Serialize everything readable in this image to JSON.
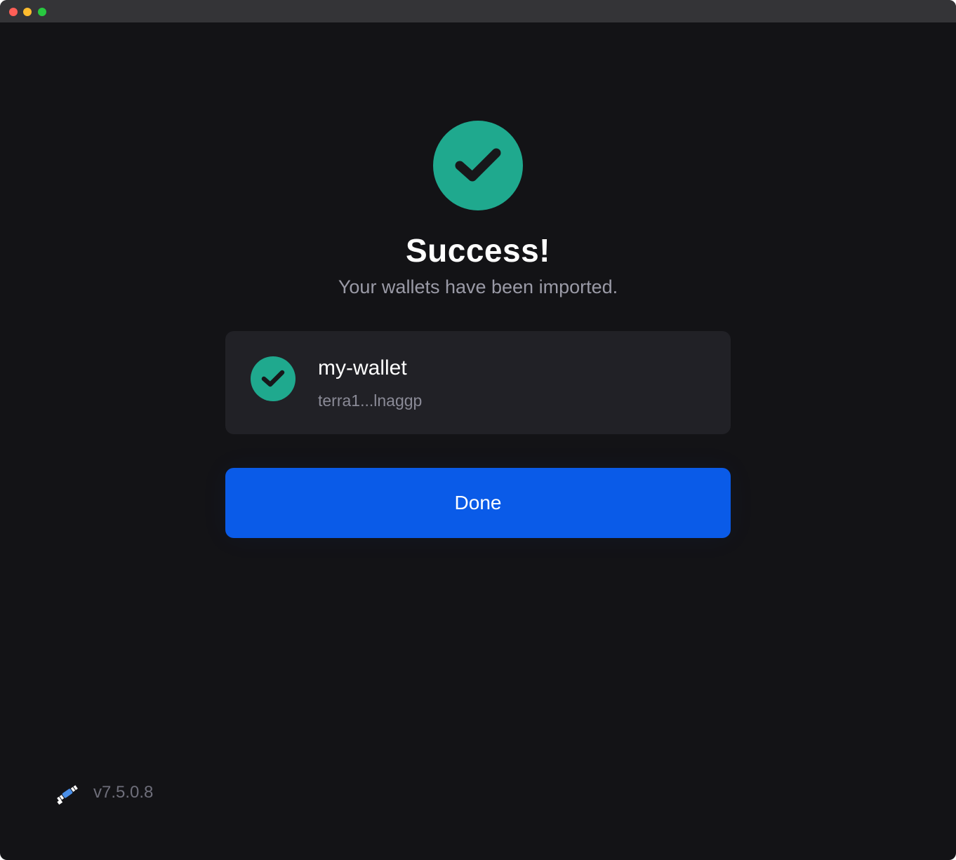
{
  "titlebar": {
    "buttons": [
      "close",
      "minimize",
      "maximize"
    ]
  },
  "success": {
    "icon": "check-circle-icon",
    "title": "Success!",
    "subtitle": "Your wallets have been imported."
  },
  "wallets": [
    {
      "icon": "check-circle-icon",
      "name": "my-wallet",
      "address": "terra1...lnaggp"
    }
  ],
  "actions": {
    "done_label": "Done"
  },
  "footer": {
    "logo": "satellite-logo-icon",
    "version": "v7.5.0.8"
  },
  "colors": {
    "background": "#131316",
    "card": "#212126",
    "accent_green": "#1fa98e",
    "primary_blue": "#0a5be8",
    "muted_text": "#9a9aa6"
  }
}
